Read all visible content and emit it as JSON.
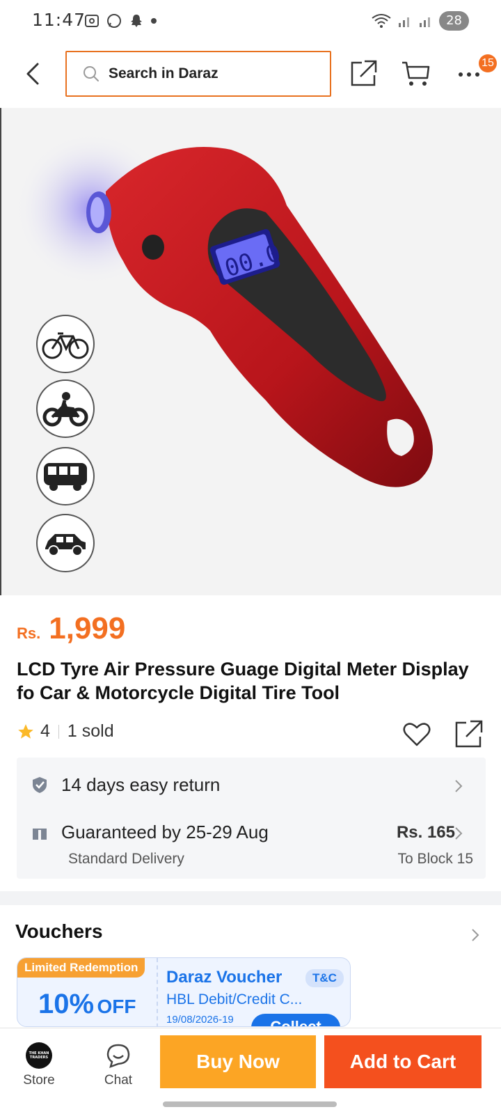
{
  "status_bar": {
    "time": "11:47",
    "battery": "28"
  },
  "header": {
    "search_placeholder": "Search in Daraz",
    "cart_badge": "15"
  },
  "product": {
    "currency": "Rs.",
    "price": "1,999",
    "title": "LCD Tyre Air Pressure Guage Digital Meter Display fo Car & Motorcycle Digital Tire Tool",
    "rating": "4",
    "sold": "1 sold",
    "lcd_reading": "00.0",
    "vehicle_icons": [
      "bicycle-icon",
      "motorcycle-icon",
      "bus-icon",
      "car-icon"
    ]
  },
  "delivery": {
    "returns": "14 days easy return",
    "guarantee": "Guaranteed by 25-29 Aug",
    "standard": "Standard Delivery",
    "fee": "Rs. 165",
    "destination": "To Block 15"
  },
  "vouchers": {
    "title": "Vouchers",
    "card": {
      "tag": "Limited Redemption",
      "percent": "10%",
      "off": "OFF",
      "name": "Daraz Voucher",
      "tc": "T&C",
      "sub": "HBL Debit/Credit C...",
      "date": "19/08/2026-19",
      "collect": "Collect"
    }
  },
  "bottom_bar": {
    "store_label": "Store",
    "store_logo_text": "THE KHAN TRADERS",
    "chat_label": "Chat",
    "buy_now": "Buy Now",
    "add_to_cart": "Add to Cart"
  },
  "colors": {
    "accent": "#f36f21",
    "buy_now": "#fca524",
    "add_to_cart": "#f4501e",
    "voucher_blue": "#1a73e8"
  }
}
